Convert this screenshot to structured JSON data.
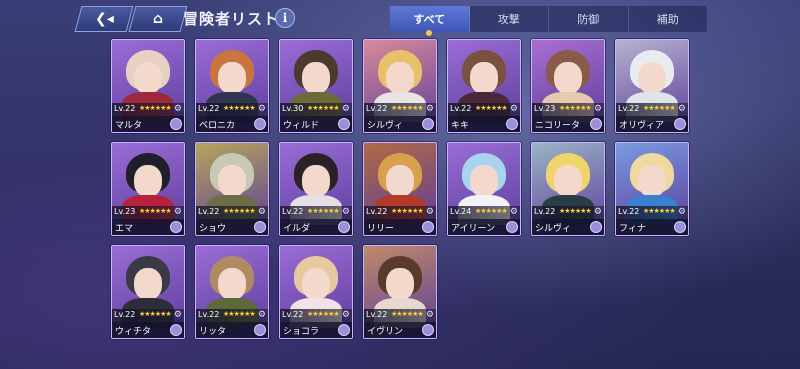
{
  "header": {
    "back_icon": "back-arrow-icon",
    "home_icon": "home-icon",
    "title": "冒険者リスト",
    "info_label": "i"
  },
  "tabs": [
    {
      "label": "すべて",
      "active": true
    },
    {
      "label": "攻撃",
      "active": false
    },
    {
      "label": "防御",
      "active": false
    },
    {
      "label": "補助",
      "active": false
    }
  ],
  "cards": [
    {
      "name": "マルタ",
      "level": "Lv.22",
      "bg": "#9a6dd6",
      "hair": "#e6d2c2",
      "body": "#9c2a3a"
    },
    {
      "name": "ベロニカ",
      "level": "Lv.22",
      "bg": "#9a6dd6",
      "hair": "#c9763e",
      "body": "#2f3550"
    },
    {
      "name": "ウィルド",
      "level": "Lv.30",
      "bg": "#9a6dd6",
      "hair": "#4c3a2e",
      "body": "#6d6a3a"
    },
    {
      "name": "シルヴィ",
      "level": "Lv.22",
      "bg": "#d98a9a",
      "hair": "#e8c06a",
      "body": "#e9e3e6"
    },
    {
      "name": "キキ",
      "level": "Lv.22",
      "bg": "#9a6dd6",
      "hair": "#7a5040",
      "body": "#4a2a3a"
    },
    {
      "name": "ニコリータ",
      "level": "Lv.23",
      "bg": "#a86fd0",
      "hair": "#8a5a4a",
      "body": "#e6c9b0"
    },
    {
      "name": "オリヴィア",
      "level": "Lv.22",
      "bg": "#b7b3cf",
      "hair": "#e8ecef",
      "body": "#dfe4ea"
    },
    {
      "name": "エマ",
      "level": "Lv.23",
      "bg": "#9a6dd6",
      "hair": "#1f1f2b",
      "body": "#b7223a"
    },
    {
      "name": "ショウ",
      "level": "Lv.22",
      "bg": "#b6a55a",
      "hair": "#c8c8b6",
      "body": "#6b6e45"
    },
    {
      "name": "イルダ",
      "level": "Lv.22",
      "bg": "#9a6dd6",
      "hair": "#2a2226",
      "body": "#e4e0e6"
    },
    {
      "name": "リリー",
      "level": "Lv.22",
      "bg": "#b06a46",
      "hair": "#d8a04a",
      "body": "#b33a2a"
    },
    {
      "name": "アイリーン",
      "level": "Lv.24",
      "bg": "#9a6dd6",
      "hair": "#a8d4f0",
      "body": "#f2f2f5"
    },
    {
      "name": "シルヴィ",
      "level": "Lv.22",
      "bg": "#9bb4c6",
      "hair": "#f0d36a",
      "body": "#2a3c44"
    },
    {
      "name": "フィナ",
      "level": "Lv.22",
      "bg": "#7a9ae0",
      "hair": "#f0d8a0",
      "body": "#3a7fd0"
    },
    {
      "name": "ウィチタ",
      "level": "Lv.22",
      "bg": "#9a6dd6",
      "hair": "#3a3a44",
      "body": "#2e2e3a"
    },
    {
      "name": "リッタ",
      "level": "Lv.22",
      "bg": "#9a6dd6",
      "hair": "#b08a62",
      "body": "#5b6a38"
    },
    {
      "name": "ショコラ",
      "level": "Lv.22",
      "bg": "#9a6dd6",
      "hair": "#e6c9a0",
      "body": "#f2e2e6"
    },
    {
      "name": "イヴリン",
      "level": "Lv.22",
      "bg": "#c08a6a",
      "hair": "#5a3a2a",
      "body": "#e8d6d0"
    }
  ],
  "icons": {
    "star": "★★★★★★",
    "gear": "⚙"
  }
}
